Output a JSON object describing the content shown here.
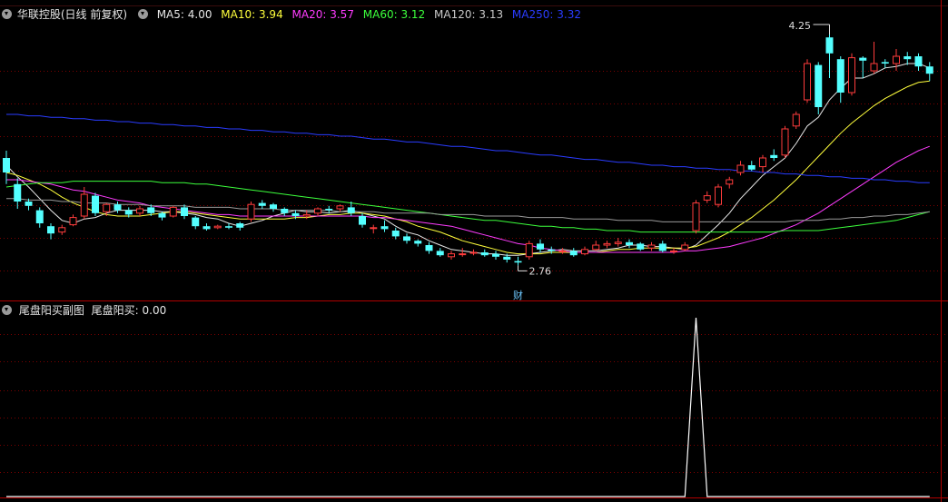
{
  "main_header": {
    "stock_name": "华联控股",
    "period_mode": "(日线 前复权)",
    "ma": [
      {
        "label": "MA5: 4.00",
        "color": "#e8e8e8"
      },
      {
        "label": "MA10: 3.94",
        "color": "#ffff3c"
      },
      {
        "label": "MA20: 3.57",
        "color": "#ff3cff"
      },
      {
        "label": "MA60: 3.12",
        "color": "#3cff3c"
      },
      {
        "label": "MA120: 3.13",
        "color": "#c8c8c8"
      },
      {
        "label": "MA250: 3.32",
        "color": "#2a3cff"
      }
    ]
  },
  "sub_header": {
    "indicator_name": "尾盘阳买副图",
    "value_label": "尾盘阳买: 0.00"
  },
  "annotations": {
    "high_price": "4.25",
    "low_price": "2.76",
    "finance_marker": "财"
  },
  "colors": {
    "up": "#ff3c3c",
    "down": "#54ffff",
    "grid": "#7a0000",
    "divider": "#b00000",
    "indicator_line": "#ffffff"
  },
  "chart_data": {
    "type": "candlestick",
    "price_range": [
      2.6,
      4.45
    ],
    "candles": [
      [
        3.5,
        3.4,
        3.55,
        3.32
      ],
      [
        3.32,
        3.2,
        3.36,
        3.15
      ],
      [
        3.2,
        3.17,
        3.22,
        3.14
      ],
      [
        3.14,
        3.05,
        3.16,
        3.02
      ],
      [
        3.03,
        2.98,
        3.05,
        2.94
      ],
      [
        2.99,
        3.02,
        3.04,
        2.97
      ],
      [
        3.04,
        3.09,
        3.11,
        3.03
      ],
      [
        3.1,
        3.25,
        3.3,
        3.08
      ],
      [
        3.24,
        3.12,
        3.26,
        3.1
      ],
      [
        3.13,
        3.18,
        3.19,
        3.1
      ],
      [
        3.18,
        3.14,
        3.2,
        3.12
      ],
      [
        3.14,
        3.11,
        3.16,
        3.09
      ],
      [
        3.12,
        3.15,
        3.17,
        3.1
      ],
      [
        3.16,
        3.12,
        3.18,
        3.1
      ],
      [
        3.12,
        3.09,
        3.13,
        3.07
      ],
      [
        3.1,
        3.16,
        3.17,
        3.09
      ],
      [
        3.16,
        3.1,
        3.18,
        3.08
      ],
      [
        3.09,
        3.03,
        3.1,
        3.01
      ],
      [
        3.03,
        3.01,
        3.05,
        3.0
      ],
      [
        3.02,
        3.03,
        3.04,
        3.01
      ],
      [
        3.03,
        3.02,
        3.05,
        3.01
      ],
      [
        3.05,
        3.02,
        3.06,
        3.0
      ],
      [
        3.08,
        3.18,
        3.2,
        3.06
      ],
      [
        3.19,
        3.17,
        3.21,
        3.15
      ],
      [
        3.18,
        3.15,
        3.19,
        3.13
      ],
      [
        3.15,
        3.12,
        3.16,
        3.1
      ],
      [
        3.12,
        3.1,
        3.14,
        3.08
      ],
      [
        3.1,
        3.11,
        3.14,
        3.08
      ],
      [
        3.12,
        3.15,
        3.16,
        3.1
      ],
      [
        3.15,
        3.14,
        3.17,
        3.12
      ],
      [
        3.15,
        3.17,
        3.18,
        3.13
      ],
      [
        3.16,
        3.12,
        3.2,
        3.1
      ],
      [
        3.1,
        3.04,
        3.12,
        3.02
      ],
      [
        3.02,
        3.02,
        3.04,
        2.98
      ],
      [
        3.03,
        3.01,
        3.07,
        2.99
      ],
      [
        3.0,
        2.96,
        3.02,
        2.94
      ],
      [
        2.96,
        2.93,
        2.98,
        2.91
      ],
      [
        2.93,
        2.91,
        2.94,
        2.89
      ],
      [
        2.9,
        2.86,
        2.92,
        2.84
      ],
      [
        2.86,
        2.83,
        2.88,
        2.82
      ],
      [
        2.82,
        2.84,
        2.86,
        2.8
      ],
      [
        2.84,
        2.84,
        2.88,
        2.82
      ],
      [
        2.85,
        2.85,
        2.87,
        2.83
      ],
      [
        2.85,
        2.83,
        2.87,
        2.82
      ],
      [
        2.84,
        2.82,
        2.86,
        2.8
      ],
      [
        2.82,
        2.8,
        2.84,
        2.78
      ],
      [
        2.79,
        2.78,
        2.82,
        2.76
      ],
      [
        2.82,
        2.91,
        2.93,
        2.8
      ],
      [
        2.91,
        2.87,
        2.94,
        2.85
      ],
      [
        2.87,
        2.86,
        2.89,
        2.84
      ],
      [
        2.86,
        2.86,
        2.88,
        2.84
      ],
      [
        2.86,
        2.83,
        2.88,
        2.82
      ],
      [
        2.84,
        2.87,
        2.89,
        2.83
      ],
      [
        2.87,
        2.9,
        2.93,
        2.86
      ],
      [
        2.9,
        2.91,
        2.93,
        2.88
      ],
      [
        2.91,
        2.92,
        2.95,
        2.89
      ],
      [
        2.92,
        2.9,
        2.94,
        2.88
      ],
      [
        2.91,
        2.87,
        2.92,
        2.86
      ],
      [
        2.88,
        2.9,
        2.92,
        2.86
      ],
      [
        2.91,
        2.86,
        2.93,
        2.85
      ],
      [
        2.86,
        2.86,
        2.88,
        2.84
      ],
      [
        2.87,
        2.9,
        2.92,
        2.86
      ],
      [
        3.0,
        3.19,
        3.21,
        2.98
      ],
      [
        3.21,
        3.24,
        3.27,
        3.19
      ],
      [
        3.18,
        3.3,
        3.32,
        3.16
      ],
      [
        3.32,
        3.35,
        3.37,
        3.29
      ],
      [
        3.4,
        3.45,
        3.48,
        3.38
      ],
      [
        3.45,
        3.42,
        3.48,
        3.41
      ],
      [
        3.44,
        3.5,
        3.52,
        3.4
      ],
      [
        3.52,
        3.5,
        3.56,
        3.48
      ],
      [
        3.52,
        3.7,
        3.72,
        3.5
      ],
      [
        3.72,
        3.8,
        3.82,
        3.7
      ],
      [
        3.9,
        4.15,
        4.18,
        3.88
      ],
      [
        4.14,
        3.85,
        4.16,
        3.8
      ],
      [
        4.33,
        4.22,
        4.35,
        4.05
      ],
      [
        4.18,
        3.95,
        4.2,
        3.88
      ],
      [
        3.95,
        4.19,
        4.22,
        3.93
      ],
      [
        4.19,
        4.17,
        4.2,
        4.05
      ],
      [
        4.1,
        4.15,
        4.3,
        4.08
      ],
      [
        4.16,
        4.15,
        4.18,
        4.12
      ],
      [
        4.15,
        4.2,
        4.25,
        4.1
      ],
      [
        4.2,
        4.18,
        4.23,
        4.14
      ],
      [
        4.2,
        4.13,
        4.22,
        4.1
      ],
      [
        4.13,
        4.08,
        4.16,
        4.03
      ]
    ],
    "ma_lines": {
      "MA5": [
        3.45,
        3.37,
        3.3,
        3.22,
        3.14,
        3.07,
        3.05,
        3.08,
        3.09,
        3.12,
        3.14,
        3.14,
        3.14,
        3.14,
        3.13,
        3.13,
        3.12,
        3.11,
        3.09,
        3.08,
        3.05,
        3.03,
        3.05,
        3.07,
        3.1,
        3.12,
        3.14,
        3.13,
        3.13,
        3.12,
        3.13,
        3.14,
        3.12,
        3.1,
        3.08,
        3.03,
        2.99,
        2.97,
        2.93,
        2.9,
        2.87,
        2.86,
        2.85,
        2.84,
        2.84,
        2.83,
        2.83,
        2.84,
        2.85,
        2.86,
        2.87,
        2.86,
        2.86,
        2.86,
        2.87,
        2.88,
        2.9,
        2.9,
        2.89,
        2.89,
        2.88,
        2.87,
        2.9,
        2.97,
        3.04,
        3.12,
        3.22,
        3.3,
        3.38,
        3.44,
        3.5,
        3.6,
        3.72,
        3.78,
        3.9,
        3.98,
        4.05,
        4.05,
        4.08,
        4.12,
        4.13,
        4.15,
        4.15,
        4.12
      ],
      "MA10": [
        3.4,
        3.38,
        3.35,
        3.32,
        3.28,
        3.23,
        3.19,
        3.16,
        3.13,
        3.11,
        3.1,
        3.1,
        3.1,
        3.11,
        3.12,
        3.13,
        3.13,
        3.12,
        3.11,
        3.1,
        3.09,
        3.08,
        3.08,
        3.08,
        3.08,
        3.08,
        3.09,
        3.09,
        3.1,
        3.11,
        3.11,
        3.12,
        3.12,
        3.11,
        3.1,
        3.08,
        3.06,
        3.03,
        3.01,
        2.99,
        2.96,
        2.93,
        2.91,
        2.89,
        2.87,
        2.85,
        2.84,
        2.84,
        2.84,
        2.85,
        2.85,
        2.85,
        2.85,
        2.85,
        2.86,
        2.87,
        2.87,
        2.88,
        2.88,
        2.88,
        2.88,
        2.88,
        2.89,
        2.92,
        2.95,
        2.99,
        3.04,
        3.09,
        3.15,
        3.21,
        3.28,
        3.35,
        3.43,
        3.51,
        3.59,
        3.67,
        3.74,
        3.8,
        3.86,
        3.91,
        3.95,
        3.99,
        4.02,
        4.03
      ],
      "MA20": [
        3.35,
        3.35,
        3.34,
        3.33,
        3.32,
        3.3,
        3.28,
        3.27,
        3.25,
        3.23,
        3.21,
        3.2,
        3.19,
        3.17,
        3.16,
        3.15,
        3.14,
        3.13,
        3.12,
        3.11,
        3.11,
        3.1,
        3.1,
        3.1,
        3.1,
        3.1,
        3.1,
        3.1,
        3.1,
        3.1,
        3.1,
        3.1,
        3.1,
        3.09,
        3.09,
        3.08,
        3.07,
        3.06,
        3.05,
        3.04,
        3.03,
        3.01,
        2.99,
        2.97,
        2.95,
        2.93,
        2.91,
        2.9,
        2.88,
        2.87,
        2.86,
        2.85,
        2.85,
        2.85,
        2.85,
        2.85,
        2.85,
        2.85,
        2.85,
        2.85,
        2.85,
        2.86,
        2.86,
        2.87,
        2.88,
        2.89,
        2.91,
        2.93,
        2.95,
        2.98,
        3.01,
        3.04,
        3.08,
        3.12,
        3.17,
        3.22,
        3.27,
        3.32,
        3.37,
        3.42,
        3.47,
        3.51,
        3.55,
        3.58
      ],
      "MA60": [
        3.3,
        3.31,
        3.32,
        3.33,
        3.33,
        3.33,
        3.34,
        3.34,
        3.34,
        3.34,
        3.34,
        3.34,
        3.34,
        3.34,
        3.33,
        3.33,
        3.33,
        3.32,
        3.32,
        3.31,
        3.3,
        3.29,
        3.28,
        3.27,
        3.26,
        3.25,
        3.24,
        3.23,
        3.22,
        3.21,
        3.2,
        3.19,
        3.18,
        3.17,
        3.16,
        3.15,
        3.14,
        3.13,
        3.12,
        3.11,
        3.1,
        3.09,
        3.08,
        3.07,
        3.07,
        3.06,
        3.05,
        3.04,
        3.03,
        3.03,
        3.02,
        3.02,
        3.01,
        3.01,
        3.0,
        3.0,
        3.0,
        2.99,
        2.99,
        2.99,
        2.99,
        2.99,
        2.99,
        2.99,
        2.99,
        2.99,
        2.99,
        2.99,
        2.99,
        2.99,
        3.0,
        3.0,
        3.0,
        3.0,
        3.01,
        3.02,
        3.03,
        3.04,
        3.05,
        3.06,
        3.07,
        3.09,
        3.11,
        3.13
      ],
      "MA120": [
        3.22,
        3.22,
        3.21,
        3.21,
        3.21,
        3.2,
        3.2,
        3.19,
        3.19,
        3.19,
        3.18,
        3.18,
        3.18,
        3.17,
        3.17,
        3.17,
        3.17,
        3.16,
        3.16,
        3.16,
        3.16,
        3.15,
        3.15,
        3.15,
        3.15,
        3.14,
        3.14,
        3.14,
        3.14,
        3.14,
        3.13,
        3.13,
        3.13,
        3.13,
        3.12,
        3.12,
        3.12,
        3.12,
        3.12,
        3.11,
        3.11,
        3.11,
        3.11,
        3.1,
        3.1,
        3.1,
        3.1,
        3.09,
        3.09,
        3.09,
        3.09,
        3.08,
        3.08,
        3.08,
        3.08,
        3.07,
        3.07,
        3.07,
        3.07,
        3.06,
        3.06,
        3.06,
        3.06,
        3.06,
        3.06,
        3.06,
        3.06,
        3.06,
        3.06,
        3.06,
        3.06,
        3.07,
        3.07,
        3.07,
        3.08,
        3.08,
        3.09,
        3.09,
        3.1,
        3.1,
        3.11,
        3.11,
        3.12,
        3.13
      ],
      "MA250": [
        3.8,
        3.8,
        3.79,
        3.79,
        3.78,
        3.78,
        3.77,
        3.77,
        3.76,
        3.76,
        3.75,
        3.75,
        3.74,
        3.74,
        3.73,
        3.73,
        3.72,
        3.72,
        3.71,
        3.71,
        3.7,
        3.7,
        3.69,
        3.69,
        3.68,
        3.68,
        3.67,
        3.67,
        3.66,
        3.66,
        3.65,
        3.65,
        3.64,
        3.63,
        3.63,
        3.62,
        3.61,
        3.61,
        3.6,
        3.59,
        3.58,
        3.58,
        3.57,
        3.56,
        3.55,
        3.55,
        3.54,
        3.53,
        3.52,
        3.52,
        3.51,
        3.5,
        3.49,
        3.49,
        3.48,
        3.47,
        3.47,
        3.46,
        3.45,
        3.45,
        3.44,
        3.44,
        3.43,
        3.43,
        3.42,
        3.42,
        3.41,
        3.41,
        3.4,
        3.4,
        3.39,
        3.39,
        3.38,
        3.38,
        3.37,
        3.37,
        3.36,
        3.36,
        3.35,
        3.35,
        3.34,
        3.34,
        3.33,
        3.33
      ]
    },
    "indicator": {
      "name": "尾盘阳买",
      "range": [
        0,
        1
      ],
      "values": [
        0,
        0,
        0,
        0,
        0,
        0,
        0,
        0,
        0,
        0,
        0,
        0,
        0,
        0,
        0,
        0,
        0,
        0,
        0,
        0,
        0,
        0,
        0,
        0,
        0,
        0,
        0,
        0,
        0,
        0,
        0,
        0,
        0,
        0,
        0,
        0,
        0,
        0,
        0,
        0,
        0,
        0,
        0,
        0,
        0,
        0,
        0,
        0,
        0,
        0,
        0,
        0,
        0,
        0,
        0,
        0,
        0,
        0,
        0,
        0,
        0,
        0,
        1,
        0,
        0,
        0,
        0,
        0,
        0,
        0,
        0,
        0,
        0,
        0,
        0,
        0,
        0,
        0,
        0,
        0,
        0,
        0,
        0,
        0
      ]
    }
  }
}
